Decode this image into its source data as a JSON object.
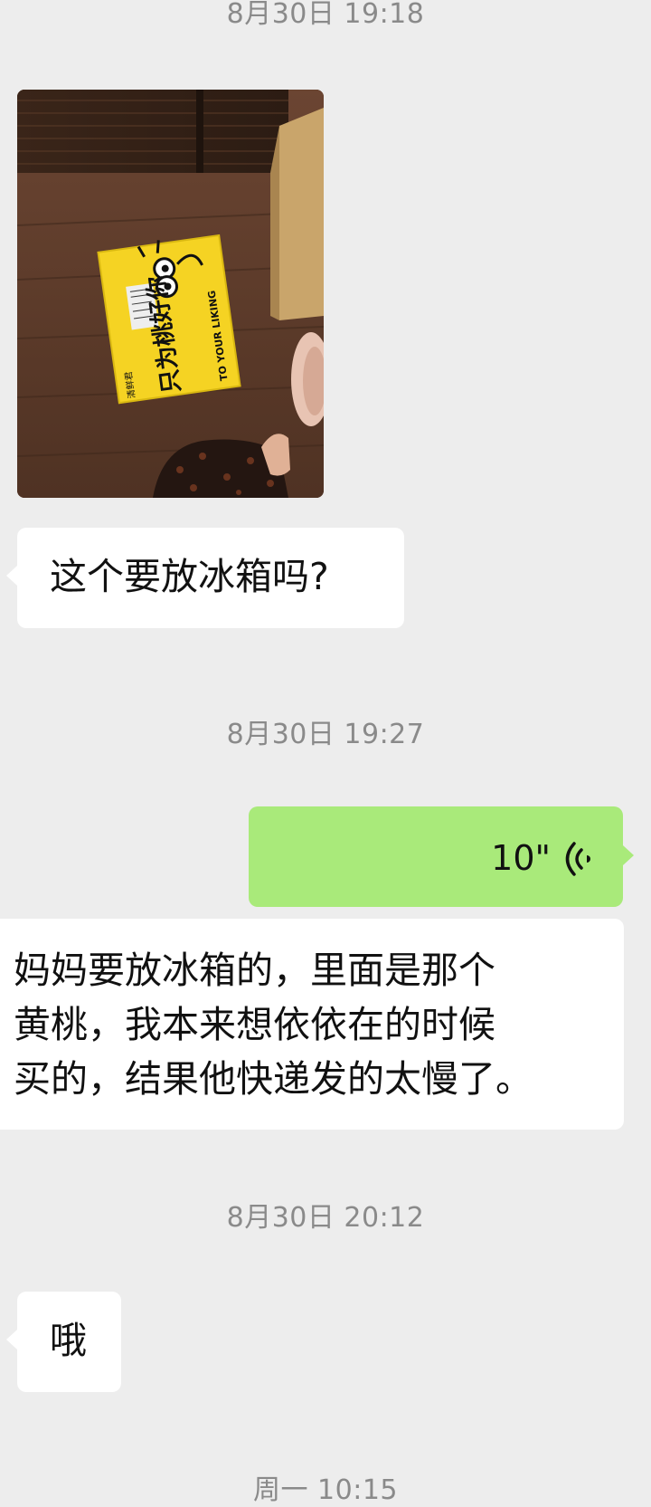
{
  "chat": {
    "messages": [
      {
        "type": "timestamp",
        "text": "8月30日 19:18"
      },
      {
        "type": "image",
        "side": "left",
        "box_text_cn": "只为桃好你",
        "box_text_en": "TO YOUR LIKING",
        "box_brand": "清鲜君"
      },
      {
        "type": "text",
        "side": "left",
        "text": "这个要放冰箱吗?"
      },
      {
        "type": "timestamp",
        "text": "8月30日 19:27"
      },
      {
        "type": "voice",
        "side": "right",
        "duration": "10\""
      },
      {
        "type": "text",
        "side": "left",
        "lines": [
          "妈妈要放冰箱的，里面是那个",
          "黄桃，我本来想依依在的时候",
          "买的，结果他快递发的太慢了。"
        ]
      },
      {
        "type": "timestamp",
        "text": "8月30日 20:12"
      },
      {
        "type": "text",
        "side": "left",
        "text": "哦"
      },
      {
        "type": "timestamp",
        "text": "周一 10:15"
      }
    ]
  },
  "colors": {
    "background": "#ededed",
    "incoming_bubble": "#ffffff",
    "outgoing_bubble": "#a9ea7a",
    "timestamp_text": "#8a8a8a",
    "package_yellow": "#f5d323"
  },
  "icons": {
    "voice": "voice-wave-icon"
  }
}
